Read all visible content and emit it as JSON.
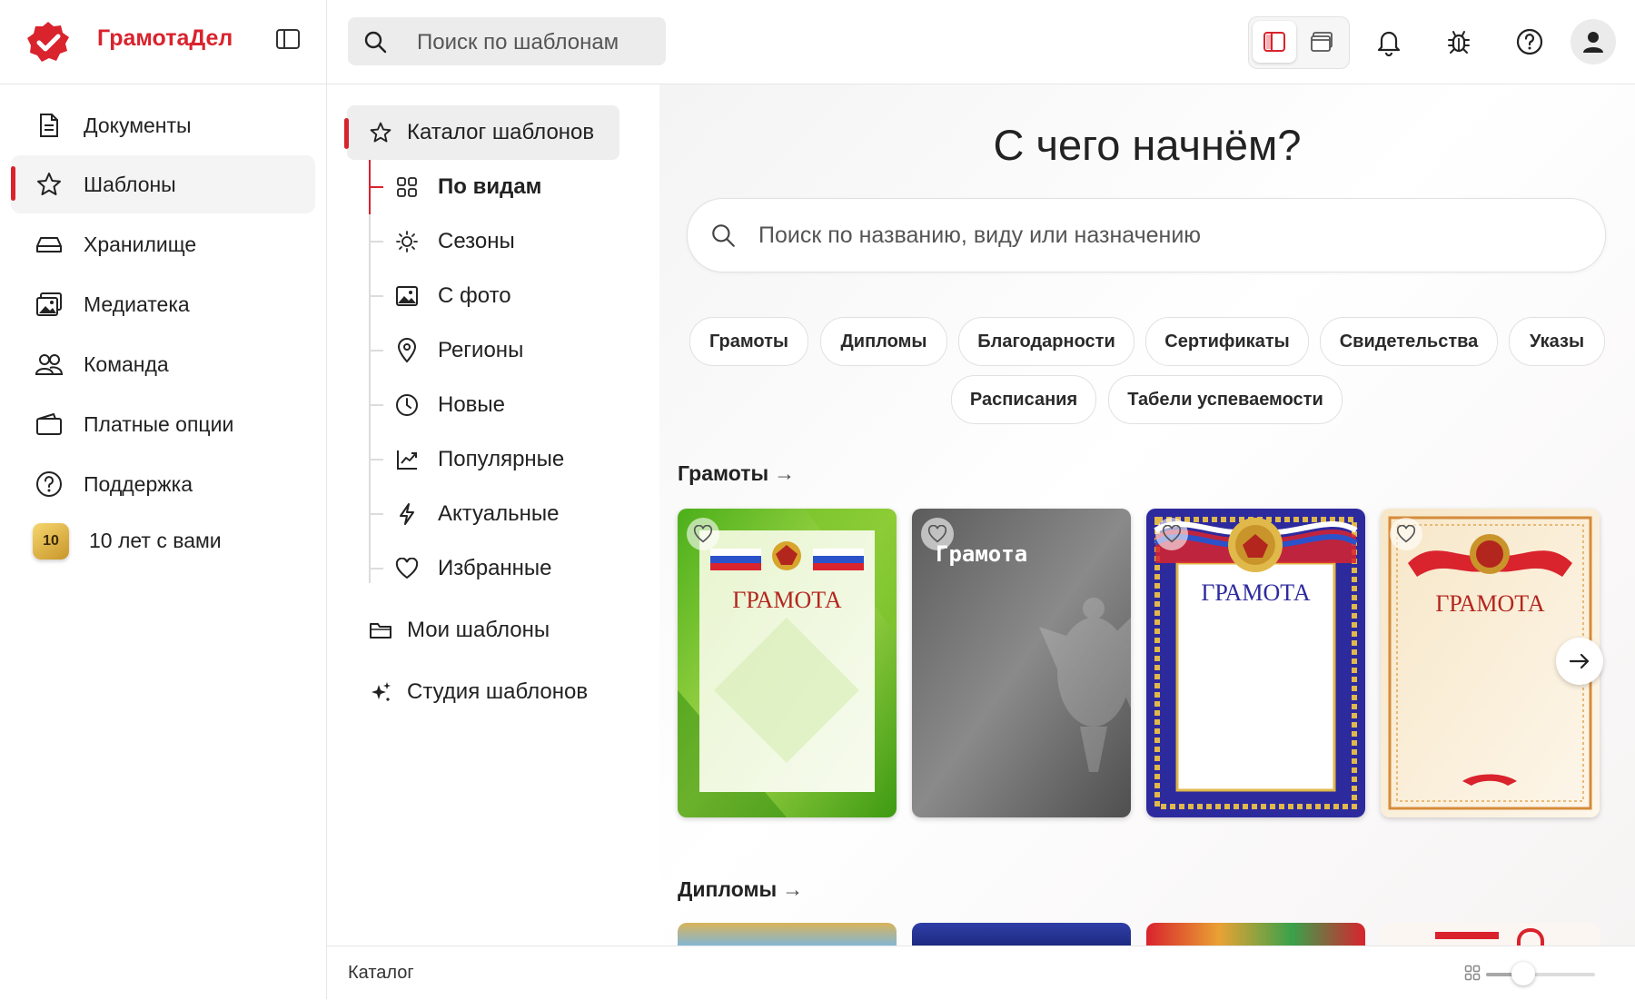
{
  "app": {
    "title": "ГрамотаДел",
    "brand_color": "#d9232d"
  },
  "header": {
    "search_placeholder": "Поиск по шаблонам",
    "icons": [
      "sidebar-view-icon",
      "window-view-icon",
      "bell-icon",
      "bug-icon",
      "help-icon",
      "user-icon"
    ]
  },
  "sidebar": {
    "items": [
      {
        "label": "Документы",
        "icon": "document-icon"
      },
      {
        "label": "Шаблоны",
        "icon": "star-icon",
        "active": true
      },
      {
        "label": "Хранилище",
        "icon": "storage-icon"
      },
      {
        "label": "Медиатека",
        "icon": "media-icon"
      },
      {
        "label": "Команда",
        "icon": "team-icon"
      },
      {
        "label": "Платные опции",
        "icon": "wallet-icon"
      },
      {
        "label": "Поддержка",
        "icon": "help-icon"
      }
    ],
    "anniversary": {
      "badge": "10",
      "label": "10 лет с вами"
    }
  },
  "catalog_nav": {
    "root": {
      "label": "Каталог шаблонов",
      "icon": "star-icon"
    },
    "children": [
      {
        "label": "По видам",
        "icon": "grid-icon",
        "active": true
      },
      {
        "label": "Сезоны",
        "icon": "sun-icon"
      },
      {
        "label": "С фото",
        "icon": "photo-icon"
      },
      {
        "label": "Регионы",
        "icon": "location-icon"
      },
      {
        "label": "Новые",
        "icon": "clock-icon"
      },
      {
        "label": "Популярные",
        "icon": "trend-icon"
      },
      {
        "label": "Актуальные",
        "icon": "lightning-icon"
      },
      {
        "label": "Избранные",
        "icon": "heart-icon"
      }
    ],
    "my_templates": {
      "label": "Мои шаблоны",
      "icon": "folder-icon"
    },
    "studio": {
      "label": "Студия шаблонов",
      "icon": "sparkle-icon"
    }
  },
  "main": {
    "hero_title": "С чего начнём?",
    "search_placeholder": "Поиск по названию, виду или назначению",
    "chips": [
      "Грамоты",
      "Дипломы",
      "Благодарности",
      "Сертификаты",
      "Свидетельства",
      "Указы",
      "Расписания",
      "Табели успеваемости"
    ],
    "sections": [
      {
        "title": "Грамоты",
        "arrow": "→",
        "cards": [
          {
            "title": "ГРАМОТА",
            "style": "green"
          },
          {
            "title": "Грамота",
            "style": "gray"
          },
          {
            "title": "ГРАМОТА",
            "style": "blue"
          },
          {
            "title": "ГРАМОТА",
            "style": "beige"
          }
        ]
      },
      {
        "title": "Дипломы",
        "arrow": "→"
      }
    ]
  },
  "statusbar": {
    "label": "Каталог",
    "zoom_level": 0.3
  }
}
